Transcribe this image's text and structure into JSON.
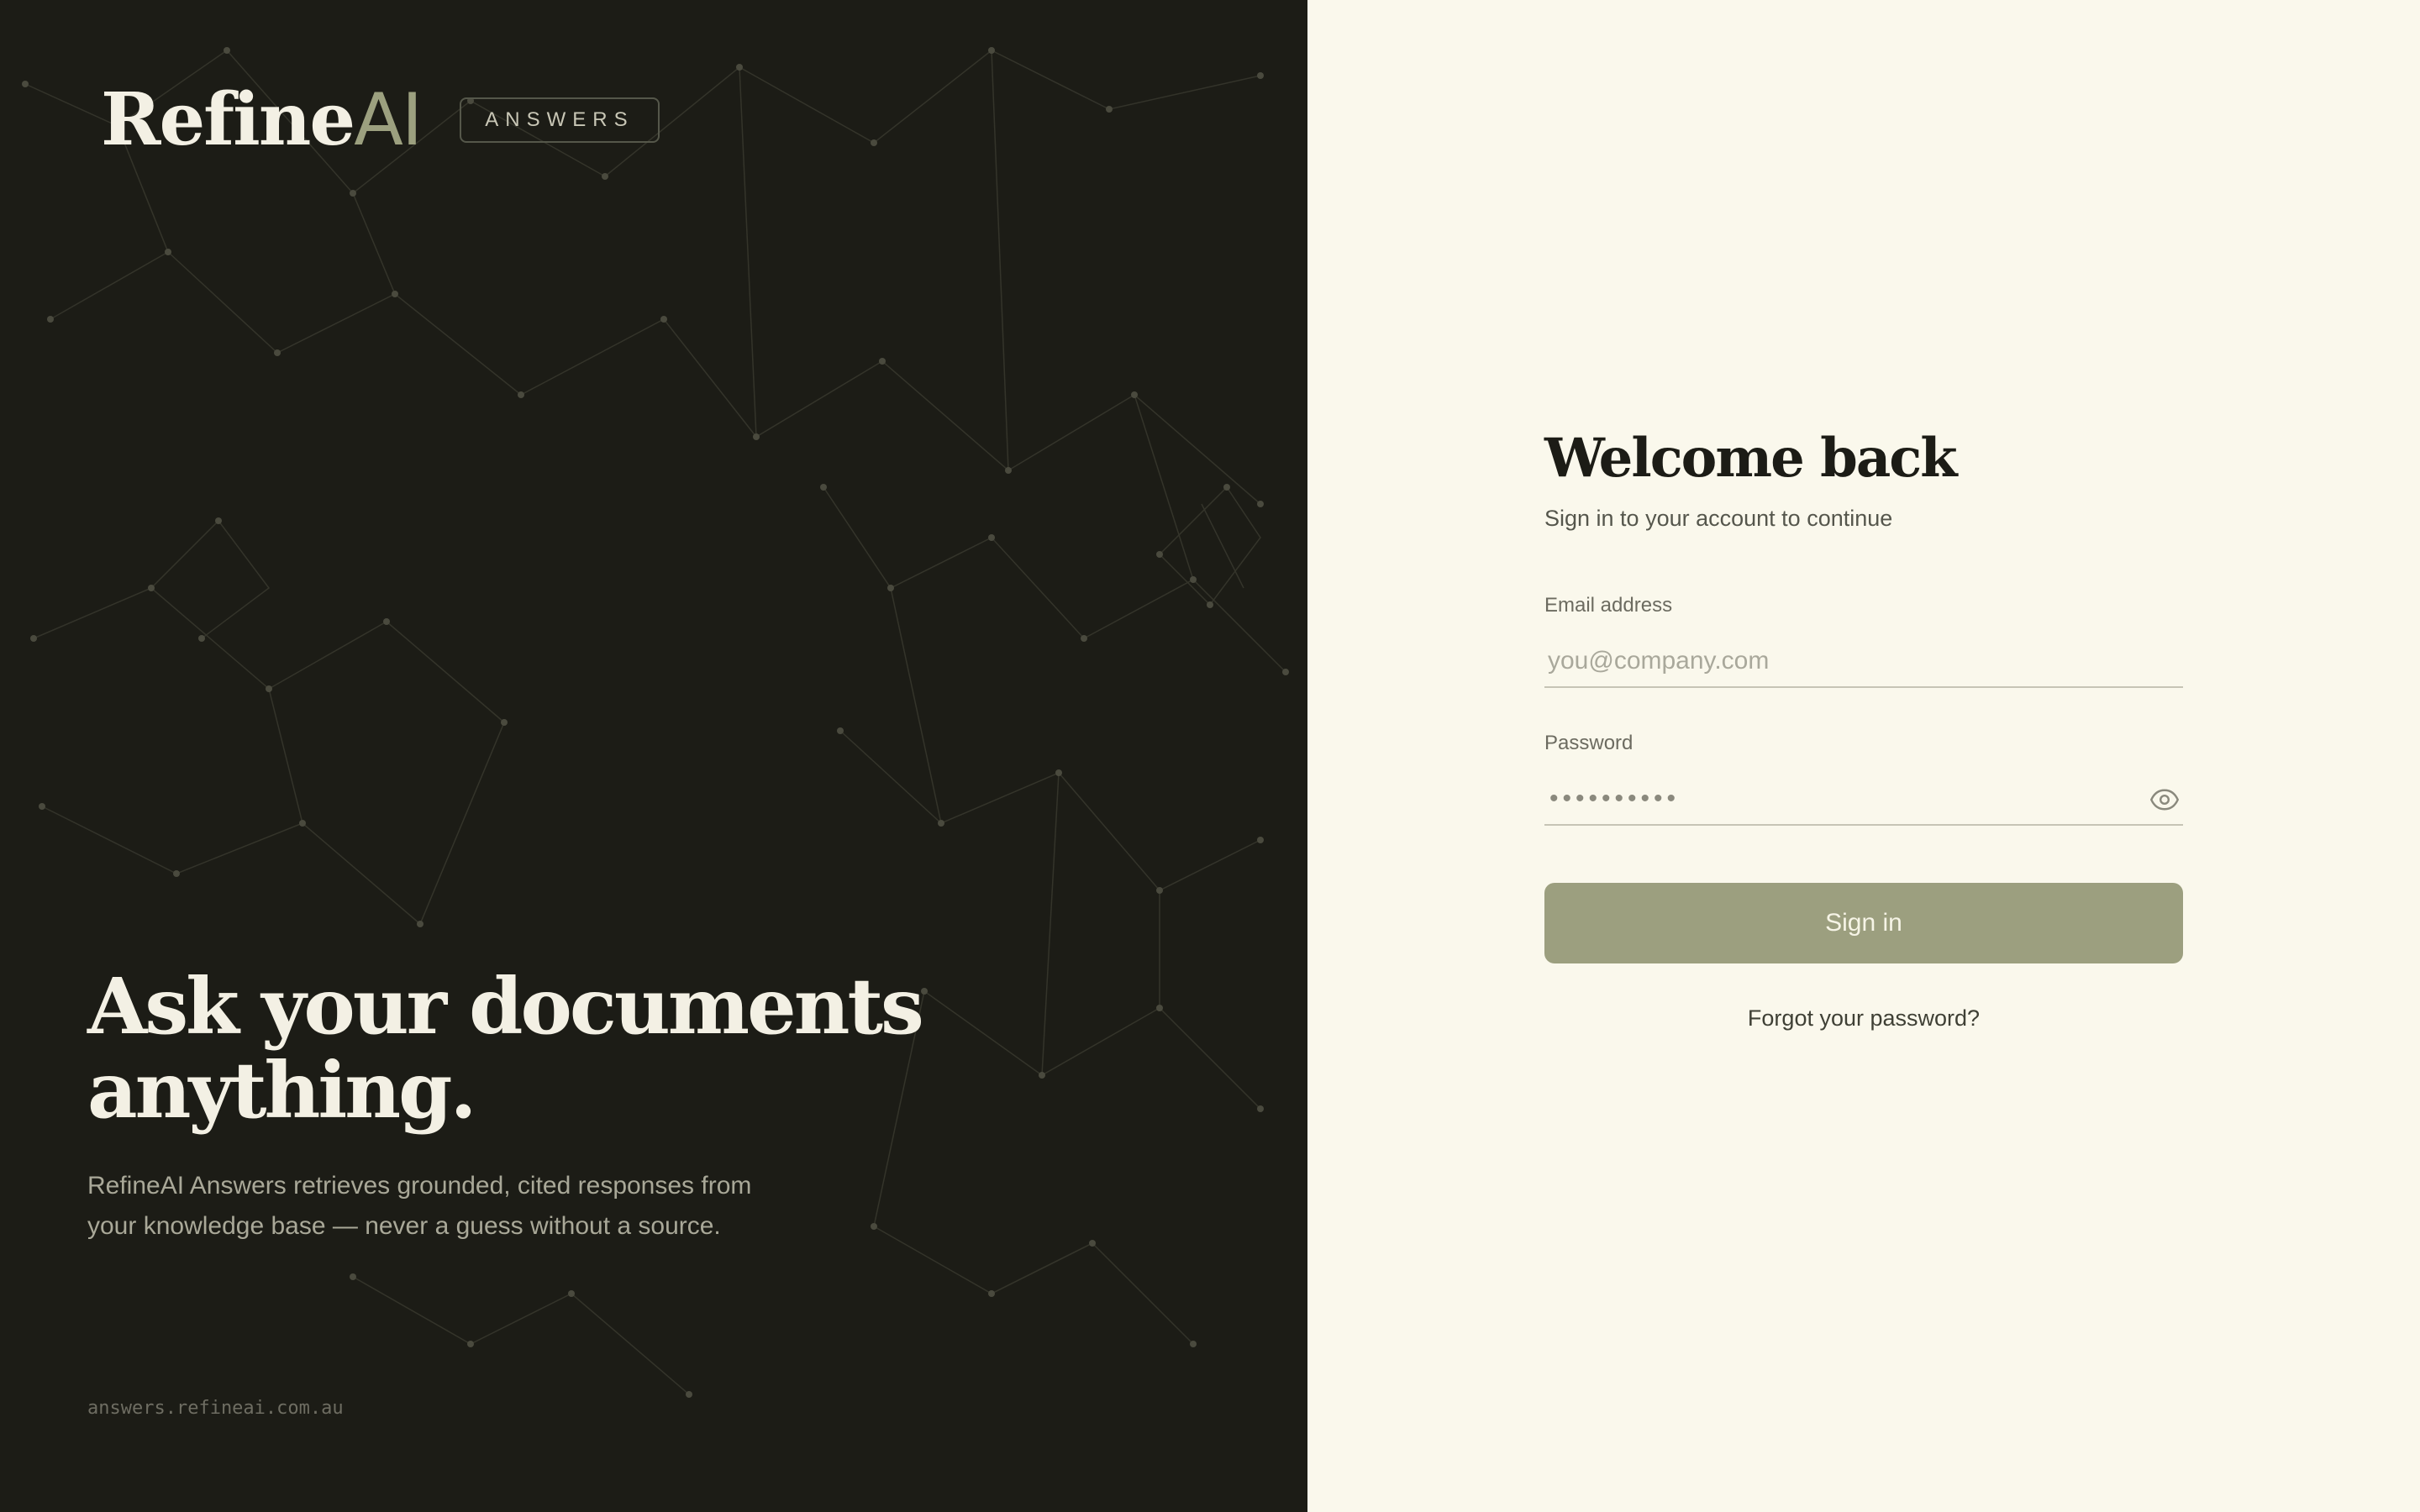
{
  "brand": {
    "name_main": "Refine",
    "name_accent": "AI",
    "badge": "ANSWERS"
  },
  "hero": {
    "title_line1": "Ask your documents",
    "title_line2": "anything.",
    "subtitle": "RefineAI Answers retrieves grounded, cited responses from your knowledge base — never a guess without a source."
  },
  "footer": {
    "domain": "answers.refineai.com.au"
  },
  "login": {
    "title": "Welcome back",
    "subtitle": "Sign in to your account to continue",
    "email_label": "Email address",
    "email_placeholder": "you@company.com",
    "password_label": "Password",
    "password_mask": "••••••••••",
    "signin_label": "Sign in",
    "forgot_label": "Forgot your password?"
  },
  "colors": {
    "panel_dark": "#1c1c16",
    "cream": "#faf8ec",
    "accent_olive": "#9c9f7f"
  },
  "icons": {
    "password_toggle": "eye-icon"
  }
}
